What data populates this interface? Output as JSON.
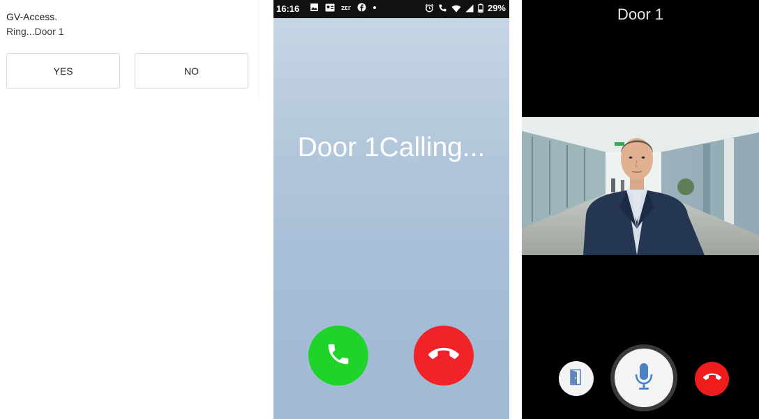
{
  "dialog": {
    "title": "GV-Access.",
    "message": "Ring...Door 1",
    "yes_label": "YES",
    "no_label": "NO"
  },
  "incoming_call": {
    "status_bar": {
      "time": "16:16",
      "battery": "29%"
    },
    "calling_text": "Door 1Calling...",
    "accept_color": "#1ed42b",
    "decline_color": "#f22328"
  },
  "video_call": {
    "title": "Door 1",
    "controls": [
      "door-open-icon",
      "microphone-icon",
      "end-call-icon"
    ]
  }
}
